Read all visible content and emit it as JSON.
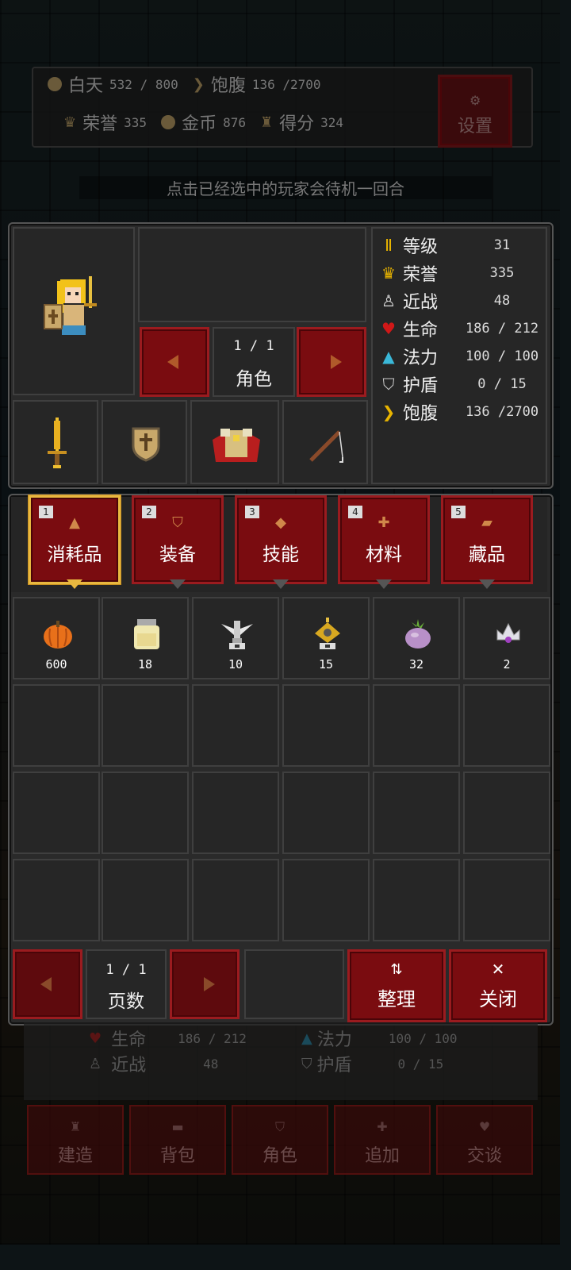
{
  "top_status": {
    "day_label": "白天",
    "day_value": "532 / 800",
    "hunger_label": "饱腹",
    "hunger_value": "136 /2700",
    "honor_label": "荣誉",
    "honor_value": "335",
    "gold_label": "金币",
    "gold_value": "876",
    "score_label": "得分",
    "score_value": "324",
    "settings_label": "设置"
  },
  "hint": "点击已经选中的玩家会待机一回合",
  "character": {
    "page": "1  /  1",
    "page_label": "角色"
  },
  "stats": [
    {
      "name": "等级",
      "value": "31",
      "icon": "pillar-icon",
      "color": "#e8b400"
    },
    {
      "name": "荣誉",
      "value": "335",
      "icon": "crown-icon",
      "color": "#e8b400"
    },
    {
      "name": "近战",
      "value": "48",
      "icon": "sword-icon",
      "color": "#dddddd"
    },
    {
      "name": "生命",
      "value": "186 / 212",
      "icon": "heart-icon",
      "color": "#d01818"
    },
    {
      "name": "法力",
      "value": "100 / 100",
      "icon": "flask-icon",
      "color": "#3ab8d8"
    },
    {
      "name": "护盾",
      "value": "0  /  15",
      "icon": "shield-icon",
      "color": "#cccccc"
    },
    {
      "name": "饱腹",
      "value": "136 /2700",
      "icon": "food-icon",
      "color": "#e8b400"
    }
  ],
  "tabs": [
    {
      "num": "1",
      "label": "消耗品",
      "icon": "potion-icon"
    },
    {
      "num": "2",
      "label": "装备",
      "icon": "armor-icon"
    },
    {
      "num": "3",
      "label": "技能",
      "icon": "gem-icon"
    },
    {
      "num": "4",
      "label": "材料",
      "icon": "material-icon"
    },
    {
      "num": "5",
      "label": "藏品",
      "icon": "scroll-icon"
    }
  ],
  "items": [
    {
      "name": "pumpkin-icon",
      "count": "600"
    },
    {
      "name": "jar-icon",
      "count": "18"
    },
    {
      "name": "winged-statue-icon",
      "count": "10"
    },
    {
      "name": "golden-totem-icon",
      "count": "15"
    },
    {
      "name": "turnip-icon",
      "count": "32"
    },
    {
      "name": "tiara-icon",
      "count": "2"
    }
  ],
  "footer": {
    "page": "1  /  1",
    "page_label": "页数",
    "sort_label": "整理",
    "close_label": "关闭"
  },
  "behind_stats": {
    "hp_label": "生命",
    "hp_value": "186 / 212",
    "mp_label": "法力",
    "mp_value": "100 / 100",
    "melee_label": "近战",
    "melee_value": "48",
    "shield_label": "护盾",
    "shield_value": "0  /  15"
  },
  "bottom_bar": [
    "建造",
    "背包",
    "角色",
    "追加",
    "交谈"
  ]
}
